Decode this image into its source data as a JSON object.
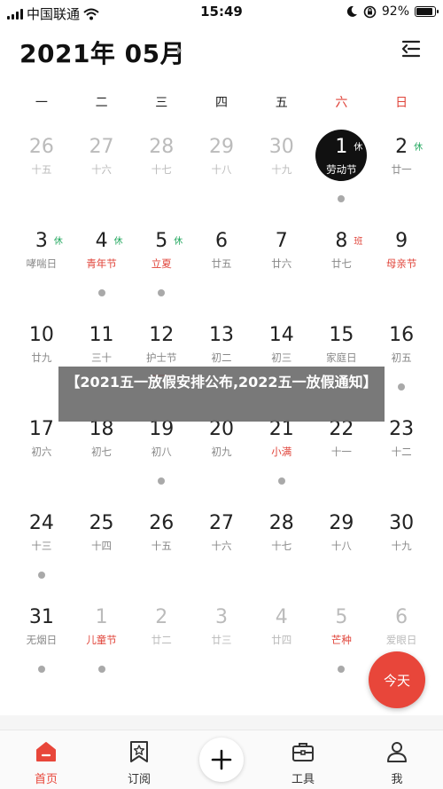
{
  "status_bar": {
    "carrier": "中国联通",
    "time": "15:49",
    "battery": "92%",
    "battery_level": 0.92
  },
  "header": {
    "month_title": "2021年 05月"
  },
  "weekdays": [
    {
      "label": "一",
      "red": false
    },
    {
      "label": "二",
      "red": false
    },
    {
      "label": "三",
      "red": false
    },
    {
      "label": "四",
      "red": false
    },
    {
      "label": "五",
      "red": false
    },
    {
      "label": "六",
      "red": true
    },
    {
      "label": "日",
      "red": true
    }
  ],
  "days": [
    {
      "num": "26",
      "lunar": "十五",
      "muted": true
    },
    {
      "num": "27",
      "lunar": "十六",
      "muted": true
    },
    {
      "num": "28",
      "lunar": "十七",
      "muted": true
    },
    {
      "num": "29",
      "lunar": "十八",
      "muted": true
    },
    {
      "num": "30",
      "lunar": "十九",
      "muted": true
    },
    {
      "num": "1",
      "lunar": "劳动节",
      "tag": "休",
      "tag_color": "green",
      "selected": true,
      "dot": true
    },
    {
      "num": "2",
      "lunar": "廿一",
      "tag": "休",
      "tag_color": "green"
    },
    {
      "num": "3",
      "lunar": "哮喘日",
      "tag": "休",
      "tag_color": "green"
    },
    {
      "num": "4",
      "lunar": "青年节",
      "lunar_red": true,
      "tag": "休",
      "tag_color": "green",
      "dot": true
    },
    {
      "num": "5",
      "lunar": "立夏",
      "lunar_red": true,
      "tag": "休",
      "tag_color": "green",
      "dot": true
    },
    {
      "num": "6",
      "lunar": "廿五"
    },
    {
      "num": "7",
      "lunar": "廿六"
    },
    {
      "num": "8",
      "lunar": "廿七",
      "tag": "班",
      "tag_color": "red"
    },
    {
      "num": "9",
      "lunar": "母亲节",
      "lunar_red": true
    },
    {
      "num": "10",
      "lunar": "廿九"
    },
    {
      "num": "11",
      "lunar": "三十"
    },
    {
      "num": "12",
      "lunar": "护士节",
      "underline": true
    },
    {
      "num": "13",
      "lunar": "初二"
    },
    {
      "num": "14",
      "lunar": "初三"
    },
    {
      "num": "15",
      "lunar": "家庭日"
    },
    {
      "num": "16",
      "lunar": "初五",
      "dot": true
    },
    {
      "num": "17",
      "lunar": "初六"
    },
    {
      "num": "18",
      "lunar": "初七"
    },
    {
      "num": "19",
      "lunar": "初八",
      "dot": true
    },
    {
      "num": "20",
      "lunar": "初九"
    },
    {
      "num": "21",
      "lunar": "小满",
      "lunar_red": true,
      "dot": true
    },
    {
      "num": "22",
      "lunar": "十一"
    },
    {
      "num": "23",
      "lunar": "十二"
    },
    {
      "num": "24",
      "lunar": "十三",
      "dot": true
    },
    {
      "num": "25",
      "lunar": "十四"
    },
    {
      "num": "26",
      "lunar": "十五"
    },
    {
      "num": "27",
      "lunar": "十六"
    },
    {
      "num": "28",
      "lunar": "十七"
    },
    {
      "num": "29",
      "lunar": "十八"
    },
    {
      "num": "30",
      "lunar": "十九"
    },
    {
      "num": "31",
      "lunar": "无烟日",
      "dot": true
    },
    {
      "num": "1",
      "lunar": "儿童节",
      "lunar_red": true,
      "muted": true,
      "dot": true
    },
    {
      "num": "2",
      "lunar": "廿二",
      "muted": true
    },
    {
      "num": "3",
      "lunar": "廿三",
      "muted": true
    },
    {
      "num": "4",
      "lunar": "廿四",
      "muted": true
    },
    {
      "num": "5",
      "lunar": "芒种",
      "lunar_red": true,
      "muted": true,
      "dot": true
    },
    {
      "num": "6",
      "lunar": "爱眼日",
      "muted": true
    }
  ],
  "banner": {
    "text": "【2021五一放假安排公布,2022五一放假通知】"
  },
  "today_button": "今天",
  "tabs": {
    "home": "首页",
    "subscribe": "订阅",
    "tools": "工具",
    "me": "我"
  },
  "colors": {
    "accent": "#e8463a",
    "holiday_green": "#23a85f",
    "selected": "#111111"
  }
}
